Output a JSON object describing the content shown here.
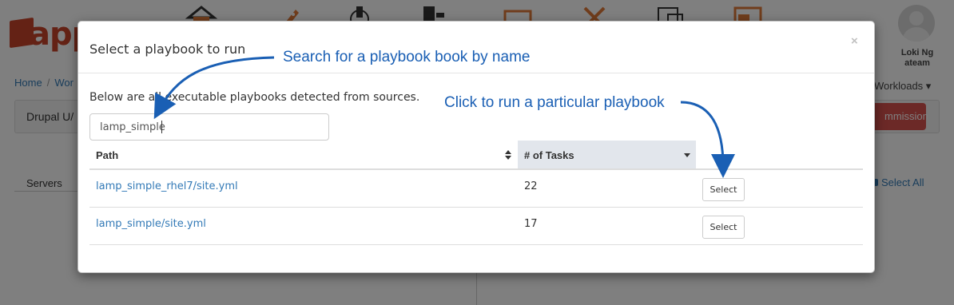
{
  "background": {
    "logo_text": "app",
    "user": {
      "name": "Loki Ng",
      "team": "ateam"
    },
    "breadcrumb": [
      "Home",
      "Wor"
    ],
    "workloads_label": "Workloads ▾",
    "panel_title": "Drupal U/",
    "primary_button_label": "mmission",
    "tab_label": "Servers",
    "select_all_label": "Select All",
    "nav_icons": [
      "home-icon",
      "rocket-icon",
      "monitor-icon",
      "server-icon",
      "document-icon",
      "tools-icon",
      "report-icon",
      "window-icon"
    ]
  },
  "modal": {
    "title": "Select a playbook to run",
    "close_label": "×",
    "description": "Below are all executable playbooks detected from sources.",
    "search": {
      "value": "lamp_simple",
      "placeholder": ""
    },
    "columns": {
      "path": "Path",
      "tasks": "# of Tasks"
    },
    "rows": [
      {
        "path": "lamp_simple_rhel7/site.yml",
        "tasks": "22",
        "action": "Select"
      },
      {
        "path": "lamp_simple/site.yml",
        "tasks": "17",
        "action": "Select"
      }
    ]
  },
  "annotations": {
    "search_hint": "Search for a playbook book by name",
    "select_hint": "Click to run a particular playbook"
  },
  "colors": {
    "link": "#337ab7",
    "annotation": "#1a5fb4",
    "brand": "#c8442a",
    "danger": "#d9534f",
    "sorted_header": "#e2e6ec"
  }
}
